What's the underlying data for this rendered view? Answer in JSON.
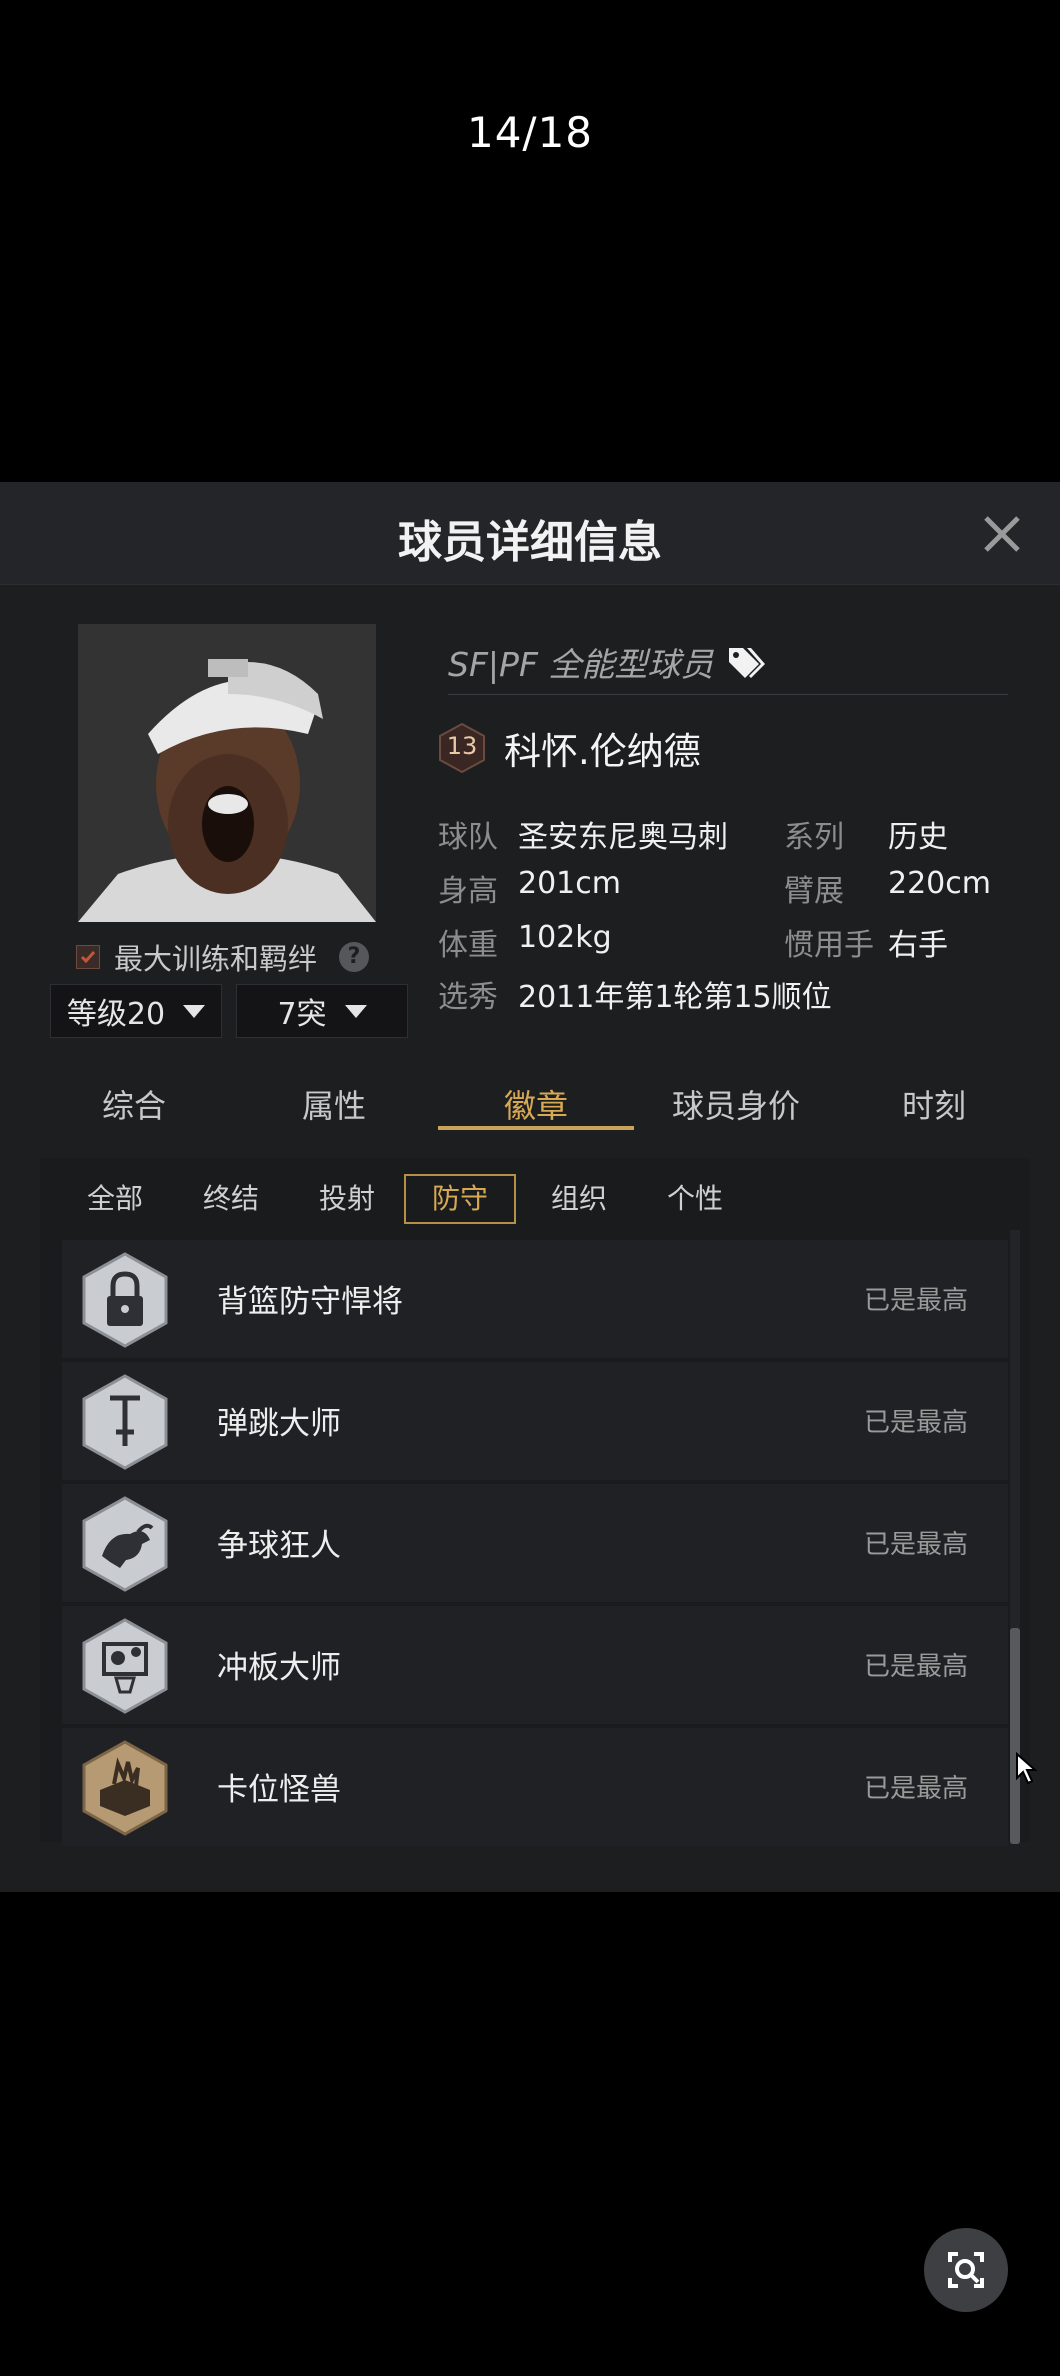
{
  "viewer": {
    "counter": "14/18"
  },
  "panel": {
    "title": "球员详细信息",
    "accent_color": "#d7a955",
    "max_training_label": "最大训练和羁绊",
    "level_dropdown": "等级20",
    "breakthrough_dropdown": "7突"
  },
  "player": {
    "role": "SF|PF 全能型球员",
    "number": "13",
    "name": "科怀.伦纳德",
    "info": [
      {
        "label": "球队",
        "value": "圣安东尼奥马刺"
      },
      {
        "label": "系列",
        "value": "历史"
      },
      {
        "label": "身高",
        "value": "201cm"
      },
      {
        "label": "臂展",
        "value": "220cm"
      },
      {
        "label": "体重",
        "value": "102kg"
      },
      {
        "label": "惯用手",
        "value": "右手"
      },
      {
        "label": "选秀",
        "value": "2011年第1轮第15顺位"
      }
    ]
  },
  "tabs": [
    "综合",
    "属性",
    "徽章",
    "球员身价",
    "时刻"
  ],
  "active_tab": "徽章",
  "subtabs": [
    "全部",
    "终结",
    "投射",
    "防守",
    "组织",
    "个性"
  ],
  "active_subtab": "防守",
  "badges": [
    {
      "name": "背篮防守悍将",
      "status": "已是最高",
      "icon": "lock-badge-icon"
    },
    {
      "name": "弹跳大师",
      "status": "已是最高",
      "icon": "pogo-stick-badge-icon"
    },
    {
      "name": "争球狂人",
      "status": "已是最高",
      "icon": "bull-badge-icon"
    },
    {
      "name": "冲板大师",
      "status": "已是最高",
      "icon": "rebound-badge-icon"
    },
    {
      "name": "卡位怪兽",
      "status": "已是最高",
      "icon": "box-out-badge-icon"
    }
  ]
}
